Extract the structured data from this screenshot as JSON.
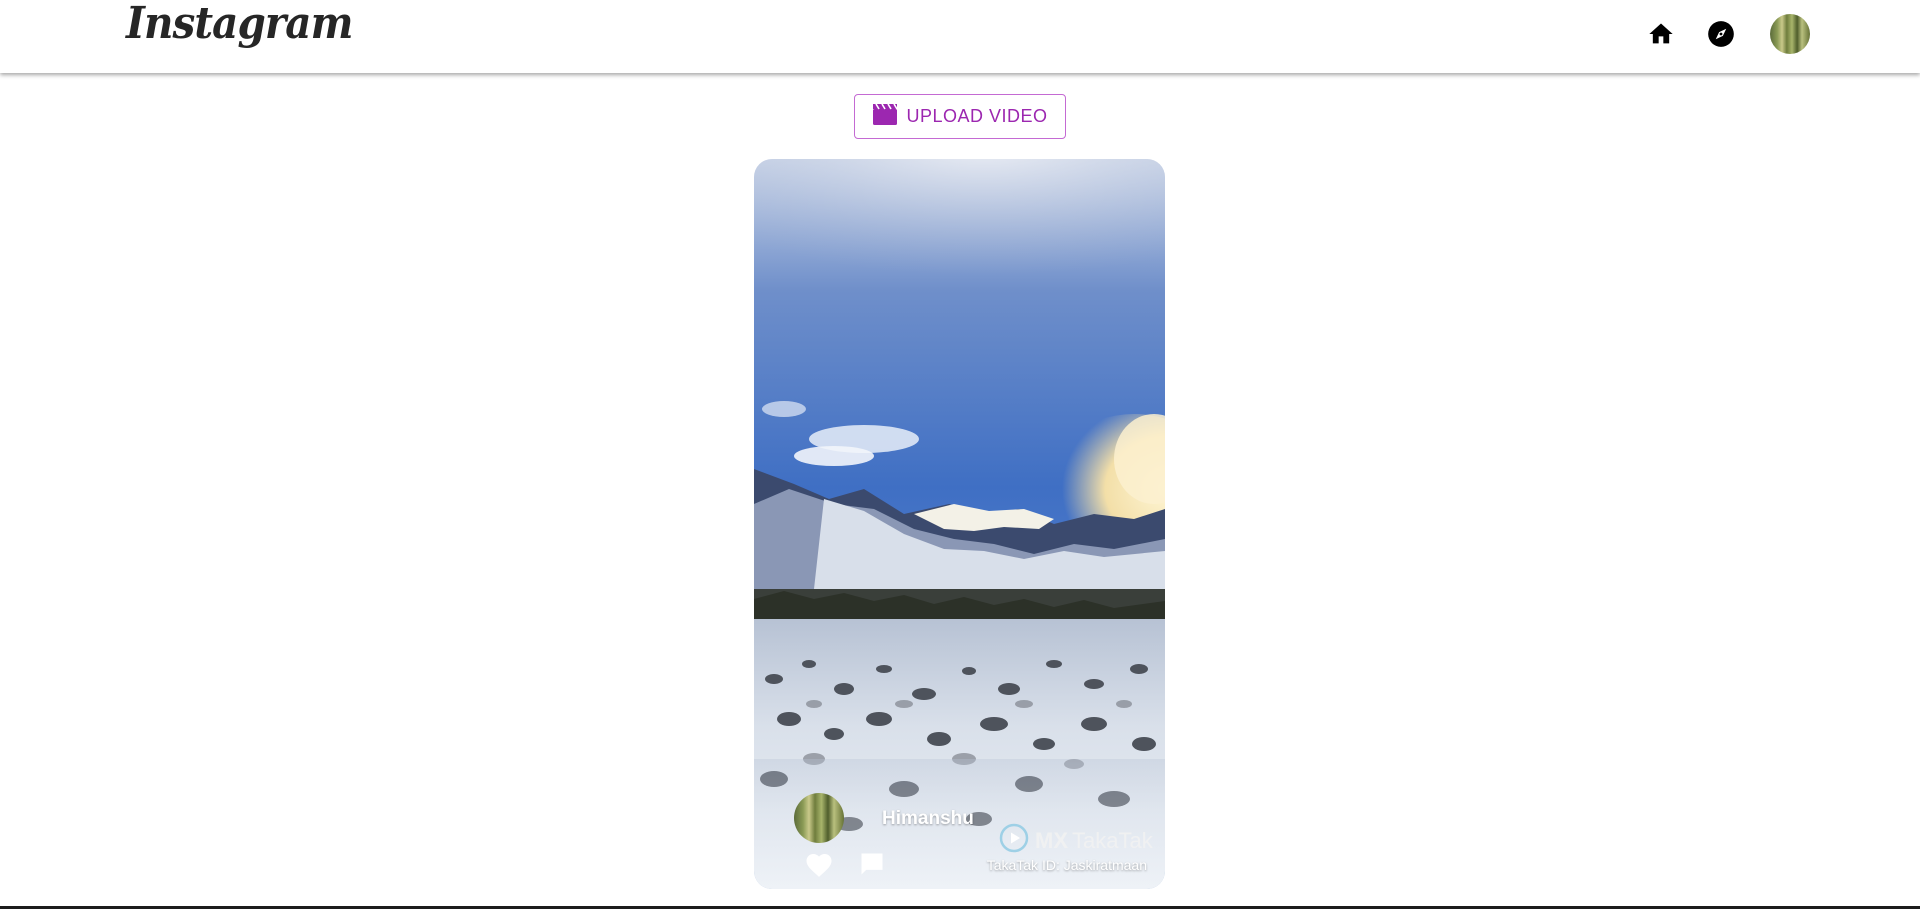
{
  "header": {
    "logo_text": "Instagram",
    "nav_icons": [
      "home-icon",
      "explore-icon",
      "profile-avatar"
    ]
  },
  "upload": {
    "label": "UPLOAD VIDEO",
    "icon": "clapperboard-icon",
    "accent_color": "#9c27b0"
  },
  "post": {
    "username": "Himanshu",
    "watermark_brand": "MX",
    "watermark_name": "TakaTak",
    "watermark_id": "TakaTak ID: Jaskiratmaan",
    "actions": [
      "heart-icon",
      "comment-icon"
    ]
  }
}
